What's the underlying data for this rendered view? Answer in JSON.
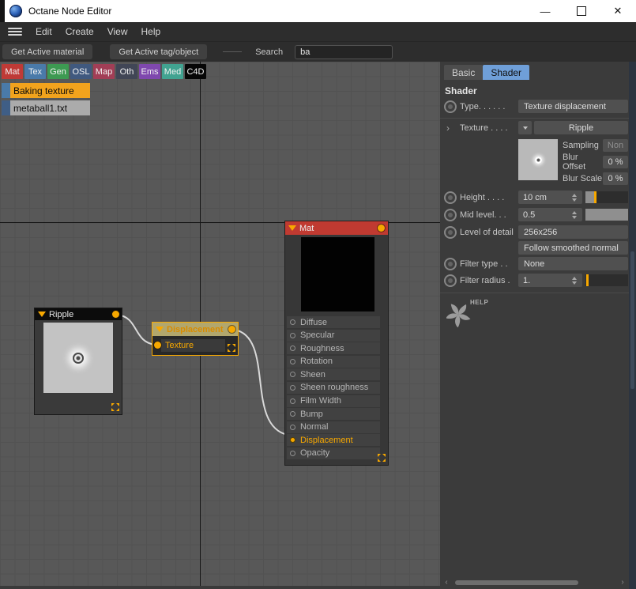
{
  "titlebar": {
    "title": "Octane Node Editor",
    "minimize_glyph": "—",
    "close_glyph": "✕"
  },
  "menubar": {
    "items": [
      "Edit",
      "Create",
      "View",
      "Help"
    ]
  },
  "toolbar": {
    "get_material": "Get Active material",
    "get_tag": "Get Active tag/object",
    "search_label": "Search",
    "search_value": "ba"
  },
  "category_tabs": [
    {
      "label": "Mat",
      "color": "#bf3a36"
    },
    {
      "label": "Tex",
      "color": "#4a7aa9"
    },
    {
      "label": "Gen",
      "color": "#3d9a52"
    },
    {
      "label": "OSL",
      "color": "#40597f"
    },
    {
      "label": "Map",
      "color": "#a23e56"
    },
    {
      "label": "Oth",
      "color": "#414656"
    },
    {
      "label": "Ems",
      "color": "#7f48ae"
    },
    {
      "label": "Med",
      "color": "#41a391"
    },
    {
      "label": "C4D",
      "color": "#060606"
    }
  ],
  "node_list": [
    {
      "label": "Baking texture",
      "bg": "#f2a31d",
      "tag": "#4a7aa9"
    },
    {
      "label": "metaball1.txt",
      "bg": "#ababab",
      "tag": "#3f5e86"
    }
  ],
  "nodes": {
    "ripple": {
      "title": "Ripple"
    },
    "displacement": {
      "title": "Displacement",
      "input": "Texture"
    },
    "mat": {
      "title": "Mat",
      "inputs": [
        "Diffuse",
        "Specular",
        "Roughness",
        "Rotation",
        "Sheen",
        "Sheen roughness",
        "Film Width",
        "Bump",
        "Normal",
        "Displacement",
        "Opacity"
      ]
    }
  },
  "inspector": {
    "tabs": {
      "basic": "Basic",
      "shader": "Shader"
    },
    "heading": "Shader",
    "type": {
      "label": "Type. . . . . .",
      "value": "Texture displacement"
    },
    "texture": {
      "label": "Texture . . . .",
      "value": "Ripple",
      "expander": "›"
    },
    "sampling": {
      "label": "Sampling",
      "value": "Non"
    },
    "blur_offset": {
      "label": "Blur Offset",
      "value": "0 %"
    },
    "blur_scale": {
      "label": "Blur Scale",
      "value": "0 %"
    },
    "height": {
      "label": "Height . . . .",
      "value": "10 cm"
    },
    "mid_level": {
      "label": "Mid level. . .",
      "value": "0.5"
    },
    "level_of_detail": {
      "label": "Level of detail",
      "value": "256x256"
    },
    "follow_smoothed": "Follow smoothed normal",
    "filter_type": {
      "label": "Filter type . .",
      "value": "None"
    },
    "filter_radius": {
      "label": "Filter radius .",
      "value": "1."
    },
    "help_label": "HELP"
  },
  "scrollbar": {
    "left_glyph": "‹",
    "right_glyph": "›"
  }
}
